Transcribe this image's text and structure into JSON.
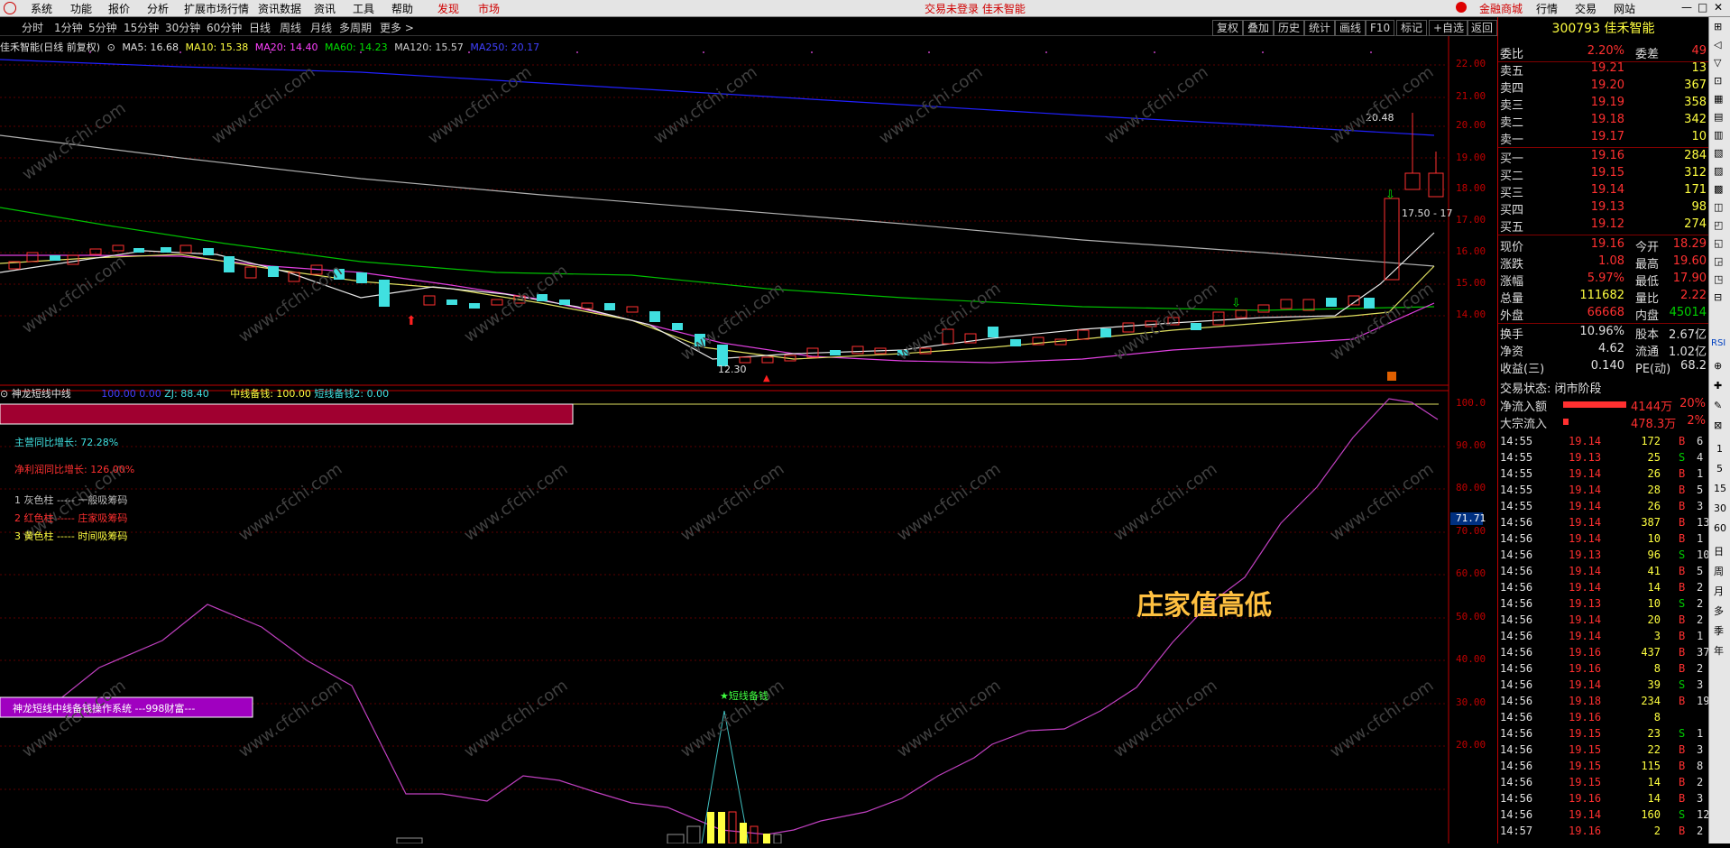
{
  "menu": {
    "items": [
      "系统",
      "功能",
      "报价",
      "分析",
      "扩展市场行情",
      "资讯数据",
      "资讯",
      "工具",
      "帮助"
    ],
    "discover": "发现",
    "market": "市场",
    "center": "交易未登录  佳禾智能",
    "right": [
      "金融商城",
      "行情",
      "交易",
      "网站"
    ]
  },
  "periods": [
    "分时",
    "1分钟",
    "5分钟",
    "15分钟",
    "30分钟",
    "60分钟",
    "日线",
    "周线",
    "月线",
    "多周期",
    "更多 >"
  ],
  "tools": [
    "复权",
    "叠加",
    "历史",
    "统计",
    "画线",
    "F10",
    "标记",
    "+自选",
    "返回"
  ],
  "ma": {
    "stock": "佳禾智能(日线 前复权)",
    "ma5": "MA5: 16.68",
    "ma10": "MA10: 15.38",
    "ma20": "MA20: 14.40",
    "ma60": "MA60: 14.23",
    "ma120": "MA120: 15.57",
    "ma250": "MA250: 20.17"
  },
  "axis_main": [
    "22.00",
    "21.00",
    "20.00",
    "19.00",
    "18.00",
    "17.00",
    "16.00",
    "15.00",
    "14.00"
  ],
  "axis_ind": [
    "100.0",
    "90.00",
    "80.00",
    "70.00",
    "60.00",
    "50.00",
    "40.00",
    "30.00",
    "20.00"
  ],
  "axis_cur": "71.71",
  "price_notes": {
    "high": "20.48",
    "low": "12.30",
    "range": "17.50 - 17"
  },
  "ind": {
    "title": "神龙短线中线",
    "v1": "100.00",
    "v2": "0.00",
    "zj": "ZJ: 88.40",
    "mid": "中线备钱: 100.00",
    "short": "短线备钱2: 0.00",
    "l1": "主营同比增长:",
    "v_l1": "72.28%",
    "l2": "净利润同比增长:",
    "v_l2": "126.00%",
    "g1": "1 灰色柱 ----- 一般吸筹码",
    "g2": "2 红色柱 ----- 庄家吸筹码",
    "g3": "3 黄色柱 -----  时间吸筹码",
    "big": "庄家值高低",
    "purple": "神龙短线中线备钱操作系统 ---998财富---",
    "star": "★短线备钱"
  },
  "watermark": "www.cfchi.com",
  "quote": {
    "code": "300793 佳禾智能",
    "rows": [
      {
        "l": "委比",
        "v": "2.20%",
        "l2": "委差",
        "v2": "49",
        "c": "red",
        "c2": "red"
      },
      {
        "l": "卖五",
        "v": "19.21",
        "v2": "13",
        "c": "red",
        "c2": "yel"
      },
      {
        "l": "卖四",
        "v": "19.20",
        "v2": "367",
        "c": "red",
        "c2": "yel"
      },
      {
        "l": "卖三",
        "v": "19.19",
        "v2": "358",
        "c": "red",
        "c2": "yel"
      },
      {
        "l": "卖二",
        "v": "19.18",
        "v2": "342",
        "c": "red",
        "c2": "yel"
      },
      {
        "l": "卖一",
        "v": "19.17",
        "v2": "10",
        "c": "red",
        "c2": "yel"
      },
      {
        "l": "买一",
        "v": "19.16",
        "v2": "284",
        "c": "red",
        "c2": "yel"
      },
      {
        "l": "买二",
        "v": "19.15",
        "v2": "312",
        "c": "red",
        "c2": "yel"
      },
      {
        "l": "买三",
        "v": "19.14",
        "v2": "171",
        "c": "red",
        "c2": "yel"
      },
      {
        "l": "买四",
        "v": "19.13",
        "v2": "98",
        "c": "red",
        "c2": "yel"
      },
      {
        "l": "买五",
        "v": "19.12",
        "v2": "274",
        "c": "red",
        "c2": "yel"
      },
      {
        "l": "现价",
        "v": "19.16",
        "l2": "今开",
        "v2": "18.29",
        "c": "red",
        "c2": "red"
      },
      {
        "l": "涨跌",
        "v": "1.08",
        "l2": "最高",
        "v2": "19.60",
        "c": "red",
        "c2": "red"
      },
      {
        "l": "涨幅",
        "v": "5.97%",
        "l2": "最低",
        "v2": "17.90",
        "c": "red",
        "c2": "red"
      },
      {
        "l": "总量",
        "v": "111682",
        "l2": "量比",
        "v2": "2.22",
        "c": "yel",
        "c2": "red"
      },
      {
        "l": "外盘",
        "v": "66668",
        "l2": "内盘",
        "v2": "45014",
        "c": "red",
        "c2": "grn"
      },
      {
        "l": "换手",
        "v": "10.96%",
        "l2": "股本",
        "v2": "2.67亿",
        "c": "wht",
        "c2": "wht"
      },
      {
        "l": "净资",
        "v": "4.62",
        "l2": "流通",
        "v2": "1.02亿",
        "c": "wht",
        "c2": "wht"
      },
      {
        "l": "收益(三)",
        "v": "0.140",
        "l2": "PE(动)",
        "v2": "68.2",
        "c": "wht",
        "c2": "wht"
      }
    ],
    "status": "交易状态: 闭市阶段",
    "netflow": {
      "l": "净流入额",
      "v": "4144万",
      "p": "20%"
    },
    "bigflow": {
      "l": "大宗流入",
      "v": "478.3万",
      "p": "2%"
    },
    "ticks": [
      [
        "14:55",
        "19.14",
        "172",
        "B",
        "6"
      ],
      [
        "14:55",
        "19.13",
        "25",
        "S",
        "4"
      ],
      [
        "14:55",
        "19.14",
        "26",
        "B",
        "1"
      ],
      [
        "14:55",
        "19.14",
        "28",
        "B",
        "5"
      ],
      [
        "14:55",
        "19.14",
        "26",
        "B",
        "3"
      ],
      [
        "14:56",
        "19.14",
        "387",
        "B",
        "13"
      ],
      [
        "14:56",
        "19.14",
        "10",
        "B",
        "1"
      ],
      [
        "14:56",
        "19.13",
        "96",
        "S",
        "10"
      ],
      [
        "14:56",
        "19.14",
        "41",
        "B",
        "5"
      ],
      [
        "14:56",
        "19.14",
        "14",
        "B",
        "2"
      ],
      [
        "14:56",
        "19.13",
        "10",
        "S",
        "2"
      ],
      [
        "14:56",
        "19.14",
        "20",
        "B",
        "2"
      ],
      [
        "14:56",
        "19.14",
        "3",
        "B",
        "1"
      ],
      [
        "14:56",
        "19.16",
        "437",
        "B",
        "37"
      ],
      [
        "14:56",
        "19.16",
        "8",
        "B",
        "2"
      ],
      [
        "14:56",
        "19.14",
        "39",
        "S",
        "3"
      ],
      [
        "14:56",
        "19.18",
        "234",
        "B",
        "19"
      ],
      [
        "14:56",
        "19.16",
        "8",
        "",
        ""
      ],
      [
        "14:56",
        "19.15",
        "23",
        "S",
        "1"
      ],
      [
        "14:56",
        "19.15",
        "22",
        "B",
        "3"
      ],
      [
        "14:56",
        "19.15",
        "115",
        "B",
        "8"
      ],
      [
        "14:56",
        "19.15",
        "14",
        "B",
        "2"
      ],
      [
        "14:56",
        "19.16",
        "14",
        "B",
        "3"
      ],
      [
        "14:56",
        "19.14",
        "160",
        "S",
        "12"
      ],
      [
        "14:57",
        "19.16",
        "2",
        "B",
        "2"
      ]
    ]
  },
  "sidebar": [
    "RSI",
    "1",
    "5",
    "15",
    "30",
    "60",
    "日",
    "周",
    "月",
    "多",
    "季",
    "年"
  ]
}
